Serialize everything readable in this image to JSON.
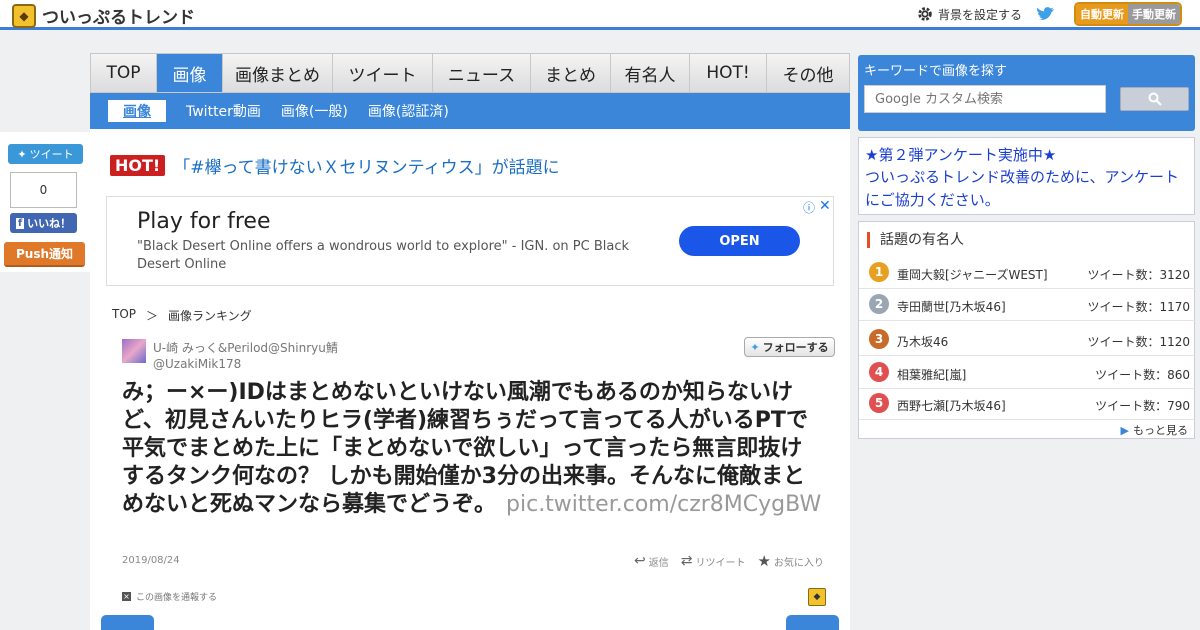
{
  "header": {
    "site_title": "ついっぷるトレンド",
    "bg_setting": "背景を設定する",
    "auto_update": "自動更新",
    "manual_update": "手動更新"
  },
  "social": {
    "tweet": "ツイート",
    "like_count": "0",
    "like": "いいね！",
    "push": "Push通知"
  },
  "nav": {
    "tabs": [
      "TOP",
      "画像",
      "画像まとめ",
      "ツイート",
      "ニュース",
      "まとめ",
      "有名人",
      "HOT!",
      "その他"
    ],
    "active_tab": 1,
    "sub": [
      "画像",
      "Twitter動画",
      "画像(一般)",
      "画像(認証済)"
    ]
  },
  "hot": {
    "badge": "HOT!",
    "text": "「#欅って書けないＸセリヌンティウス」が話題に"
  },
  "ad": {
    "title": "Play for free",
    "desc": "\"Black Desert Online offers a wondrous world to explore\" - IGN. on PC Black Desert Online",
    "open": "OPEN"
  },
  "breadcrumb": [
    "TOP",
    "＞",
    "画像ランキング"
  ],
  "tweet": {
    "user_name": "U-崎 みっく&Perilod@Shinryu鯖",
    "handle": "@UzakiMik178",
    "follow": "フォローする",
    "text": "み；ー×ー)IDはまとめないといけない風潮でもあるのか知らないけど、初見さんいたりヒラ(学者)練習ちぅだって言ってる人がいるPTで平気でまとめた上に「まとめないで欲しい」って言ったら無言即抜けするタンク何なの？ しかも開始僅か3分の出来事。そんなに俺敵まとめないと死ぬマンなら募集でどうぞ。",
    "link": "pic.twitter.com/czr8MCygBW",
    "date": "2019/08/24",
    "reply": "返信",
    "retweet": "リツイート",
    "favorite": "お気に入り",
    "report": "この画像を通報する"
  },
  "sidebar": {
    "search_title": "キーワードで画像を探す",
    "search_placeholder": "Google カスタム検索",
    "survey_title": "★第２弾アンケート実施中★",
    "survey_body": "ついっぷるトレンド改善のために、アンケートにご協力ください。",
    "celeb_title": "話題の有名人",
    "celebs": [
      {
        "rank": "1",
        "name": "重岡大毅[ジャニーズWEST]",
        "count": "ツイート数：3120"
      },
      {
        "rank": "2",
        "name": "寺田蘭世[乃木坂46]",
        "count": "ツイート数：1170"
      },
      {
        "rank": "3",
        "name": "乃木坂46",
        "count": "ツイート数：1120"
      },
      {
        "rank": "4",
        "name": "相葉雅紀[嵐]",
        "count": "ツイート数：860"
      },
      {
        "rank": "5",
        "name": "西野七瀬[乃木坂46]",
        "count": "ツイート数：790"
      }
    ],
    "more": "もっと見る"
  },
  "colors": {
    "accent": "#3b86d8",
    "hot": "#cc1f1f",
    "rank1": "#e8a020",
    "rank2": "#9aa6b4",
    "rank3": "#c86a2a",
    "rank4": "#e05050",
    "rank5": "#e05050"
  }
}
